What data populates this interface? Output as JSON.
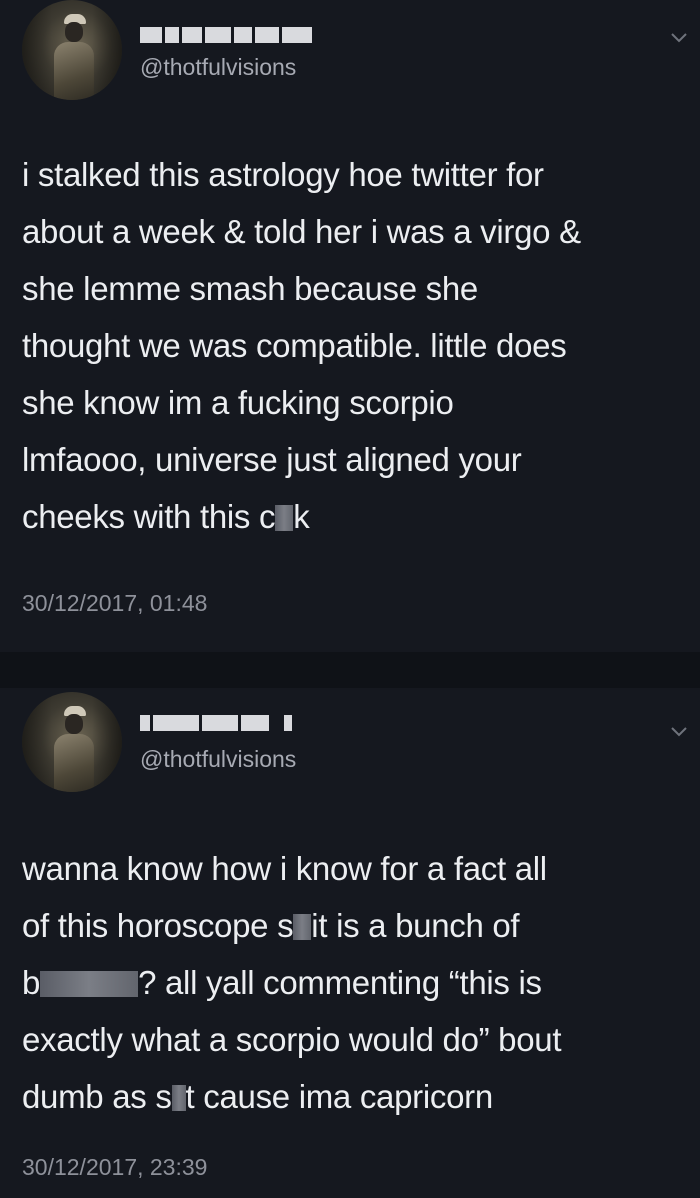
{
  "tweets": [
    {
      "handle": "@thotfulvisions",
      "lines": [
        "i stalked this astrology hoe twitter for",
        "about a week & told her i was a virgo &",
        "she lemme smash because she",
        "thought we was compatible. little does",
        "she know im a fucking scorpio",
        "lmfaooo, universe just aligned your"
      ],
      "last_line_before": "cheeks with this c",
      "last_line_after": "k",
      "timestamp": "30/12/2017, 01:48"
    },
    {
      "handle": "@thotfulvisions",
      "line1": "wanna know how i know for a fact all",
      "line2_before": "of this horoscope s",
      "line2_after": "it is a bunch of",
      "line3_before": "b",
      "line3_after": "? all yall commenting “this is",
      "line4": "exactly what a scorpio would do” bout",
      "line5_before": "dumb as s",
      "line5_after": "t cause ima capricorn",
      "timestamp": "30/12/2017, 23:39"
    }
  ],
  "icons": {
    "avatar": "profile-photo",
    "menu": "chevron-down-icon"
  },
  "colors": {
    "background": "#15181f",
    "text": "#eceef1",
    "secondary_text": "#a7aab3"
  }
}
